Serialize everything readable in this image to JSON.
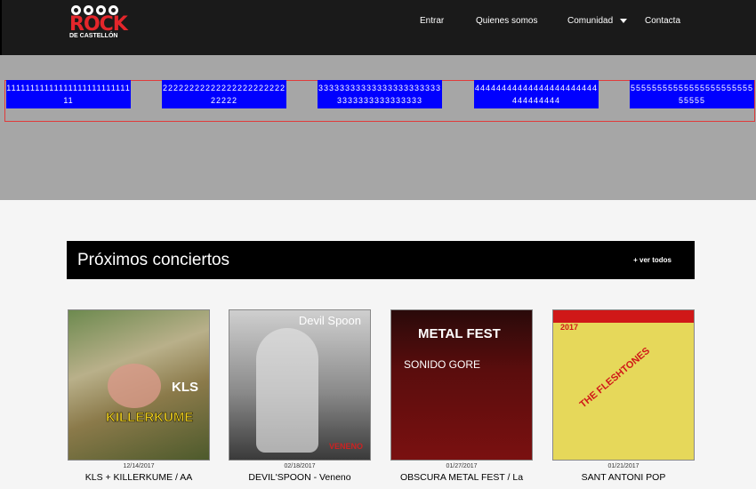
{
  "header": {
    "logo_top": "ROCK",
    "logo_sub": "DE CASTELLÓN",
    "nav": [
      "Entrar",
      "Quienes somos",
      "Comunidad",
      "Contacta"
    ]
  },
  "slider": {
    "slides": [
      "1111111111111111111111111111",
      "2222222222222222222222222222",
      "333333333333333333333333333333333333333",
      "44444444444444444444444444444444",
      "5555555555555555555555555555"
    ]
  },
  "concerts": {
    "heading": "Próximos conciertos",
    "more": "+ ver todos",
    "items": [
      {
        "date": "12/14/2017",
        "title": "KLS + KILLERKUME / AA",
        "poster_text": "KILLERKUME",
        "poster_badge": "KLS"
      },
      {
        "date": "02/18/2017",
        "title": "DEVIL'SPOON - Veneno",
        "poster_text": "Devil Spoon",
        "poster_badge": "VENENO"
      },
      {
        "date": "01/27/2017",
        "title": "OBSCURA METAL FEST / La",
        "poster_text": "METAL FEST",
        "poster_badge": "SONIDO GORE"
      },
      {
        "date": "01/21/2017",
        "title": "SANT ANTONI POP",
        "poster_text": "THE FLESHTONES",
        "poster_badge": "2017"
      }
    ]
  },
  "colors": {
    "slide_bg": "#0000ff",
    "nav_bg": "#1a1a1a",
    "logo": "#e4262b"
  }
}
